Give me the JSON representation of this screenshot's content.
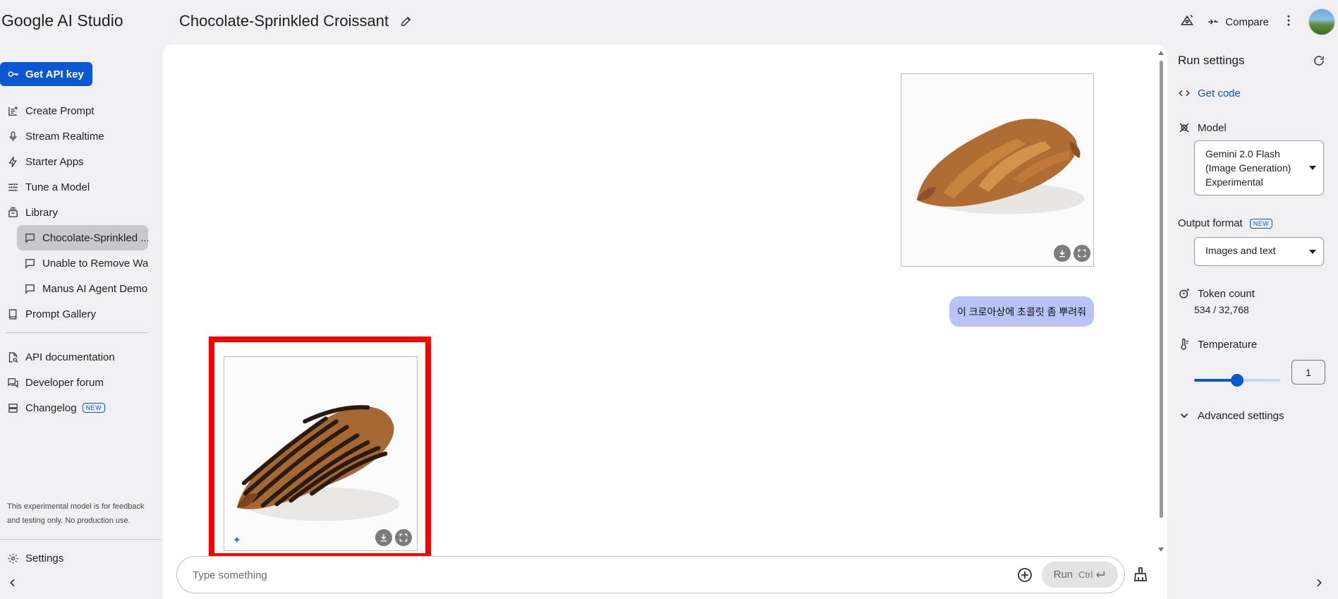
{
  "app": {
    "brand": "Google AI Studio",
    "title": "Chocolate-Sprinkled Croissant"
  },
  "sidebar": {
    "api_key_label": "Get API key",
    "items": [
      {
        "label": "Create Prompt"
      },
      {
        "label": "Stream Realtime"
      },
      {
        "label": "Starter Apps"
      },
      {
        "label": "Tune a Model"
      },
      {
        "label": "Library"
      }
    ],
    "library": [
      {
        "label": "Chocolate-Sprinkled ..."
      },
      {
        "label": "Unable to Remove Wa..."
      },
      {
        "label": "Manus AI Agent Demo"
      }
    ],
    "prompt_gallery": "Prompt Gallery",
    "links": [
      {
        "label": "API documentation"
      },
      {
        "label": "Developer forum"
      },
      {
        "label": "Changelog",
        "badge": "NEW"
      }
    ],
    "notice": "This experimental model is for feedback and testing only. No production use.",
    "settings": "Settings"
  },
  "topbar": {
    "compare_label": "Compare"
  },
  "chat": {
    "user_message": "이 크로아상에 초콜릿 좀 뿌려줘",
    "input_placeholder": "Type something",
    "run_label": "Run",
    "run_shortcut": "Ctrl"
  },
  "run_settings": {
    "title": "Run settings",
    "get_code": "Get code",
    "model_label": "Model",
    "model_value": "Gemini 2.0 Flash (Image Generation) Experimental",
    "output_format_label": "Output format",
    "output_format_badge": "NEW",
    "output_format_value": "Images and text",
    "token_count_label": "Token count",
    "token_count_value": "534 / 32,768",
    "temperature_label": "Temperature",
    "temperature_value": "1",
    "temperature_fraction": 0.5,
    "advanced_label": "Advanced settings"
  },
  "colors": {
    "accent": "#0b57d0",
    "user_bubble": "#b8c4f6",
    "highlight": "#ff0000"
  }
}
